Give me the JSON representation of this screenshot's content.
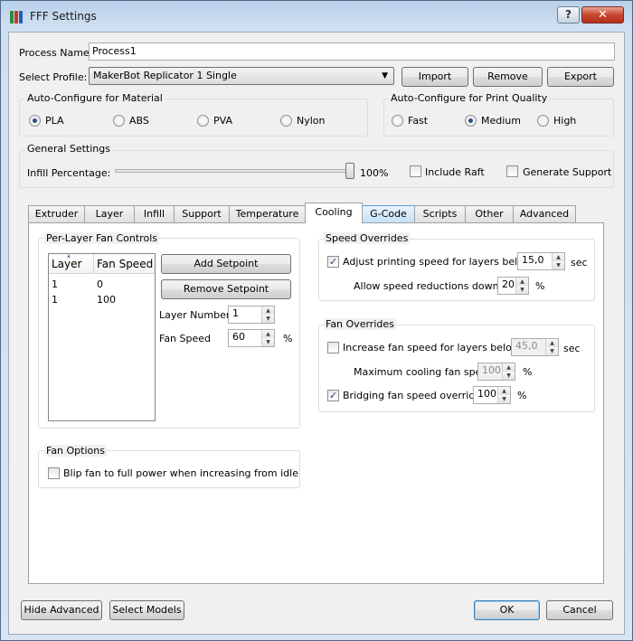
{
  "window": {
    "title": "FFF Settings",
    "help_glyph": "?",
    "close_glyph": "✕"
  },
  "colors": {
    "accent": "#3c7fb1",
    "tab_hover": "#c5e2f9",
    "checkmark": "#2b3f6b"
  },
  "process": {
    "label": "Process Name:",
    "value": "Process1"
  },
  "profile": {
    "label": "Select Profile:",
    "selected": "MakerBot Replicator 1 Single",
    "import": "Import",
    "remove": "Remove",
    "export": "Export"
  },
  "material": {
    "title": "Auto-Configure for Material",
    "options": [
      {
        "label": "PLA",
        "selected": true
      },
      {
        "label": "ABS",
        "selected": false
      },
      {
        "label": "PVA",
        "selected": false
      },
      {
        "label": "Nylon",
        "selected": false
      }
    ]
  },
  "quality": {
    "title": "Auto-Configure for Print Quality",
    "options": [
      {
        "label": "Fast",
        "selected": false
      },
      {
        "label": "Medium",
        "selected": true
      },
      {
        "label": "High",
        "selected": false
      }
    ]
  },
  "general": {
    "title": "General Settings",
    "infill_label": "Infill Percentage:",
    "infill_value_text": "100%",
    "infill_value": 100,
    "include_raft": "Include Raft",
    "generate_support": "Generate Support"
  },
  "tabs": [
    {
      "label": "Extruder"
    },
    {
      "label": "Layer"
    },
    {
      "label": "Infill"
    },
    {
      "label": "Support"
    },
    {
      "label": "Temperature"
    },
    {
      "label": "Cooling"
    },
    {
      "label": "G-Code"
    },
    {
      "label": "Scripts"
    },
    {
      "label": "Other"
    },
    {
      "label": "Advanced"
    }
  ],
  "active_tab": "Cooling",
  "fan_controls": {
    "title": "Per-Layer Fan Controls",
    "columns": [
      "Layer",
      "Fan Speed"
    ],
    "rows": [
      [
        "1",
        "0"
      ],
      [
        "1",
        "100"
      ]
    ],
    "add_setpoint": "Add Setpoint",
    "remove_setpoint": "Remove Setpoint",
    "layer_number_label": "Layer Number",
    "layer_number_value": "1",
    "fan_speed_label": "Fan Speed",
    "fan_speed_value": "60",
    "fan_speed_unit": "%"
  },
  "fan_options": {
    "title": "Fan Options",
    "blip_label": "Blip fan to full power when increasing from idle",
    "blip_checked": false
  },
  "speed_overrides": {
    "title": "Speed Overrides",
    "adjust_label": "Adjust printing speed for layers below",
    "adjust_checked": true,
    "adjust_value": "15,0",
    "adjust_unit": "sec",
    "allow_label": "Allow speed reductions down to",
    "allow_value": "20",
    "allow_unit": "%"
  },
  "fan_overrides": {
    "title": "Fan Overrides",
    "increase_label": "Increase fan speed for layers below",
    "increase_checked": false,
    "increase_value": "45,0",
    "increase_unit": "sec",
    "max_cooling_label": "Maximum cooling fan speed",
    "max_cooling_value": "100",
    "max_cooling_unit": "%",
    "bridging_label": "Bridging fan speed override",
    "bridging_checked": true,
    "bridging_value": "100",
    "bridging_unit": "%"
  },
  "footer": {
    "hide_advanced": "Hide Advanced",
    "select_models": "Select Models",
    "ok": "OK",
    "cancel": "Cancel"
  },
  "glyphs": {
    "checkmark": "✓",
    "combo_arrow": "▼",
    "spin_up": "▲",
    "spin_down": "▼",
    "sort_arrow": "▴"
  }
}
